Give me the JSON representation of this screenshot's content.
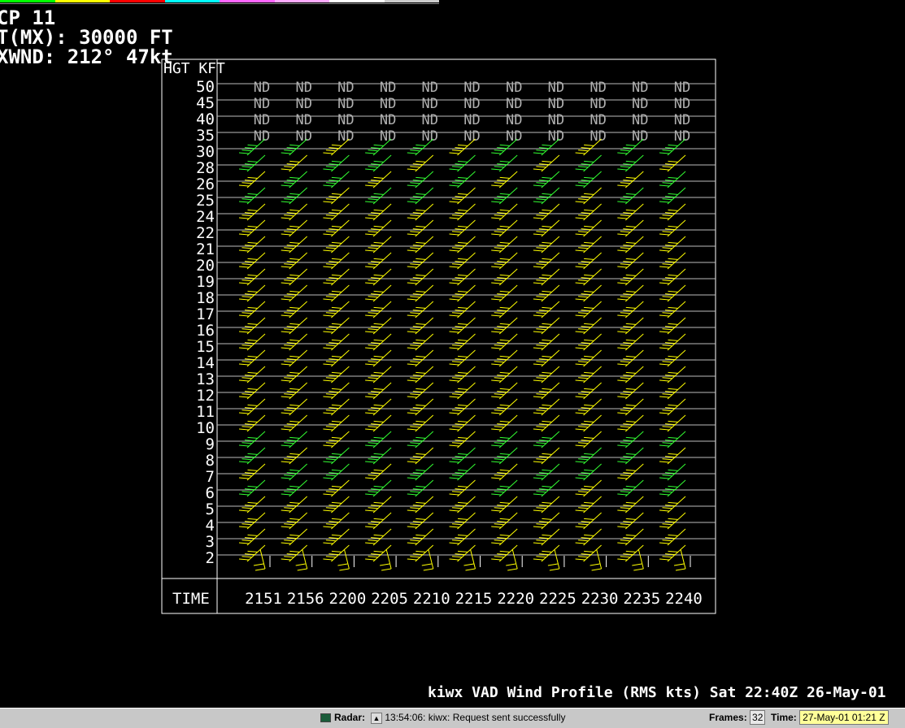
{
  "header": {
    "line1": "CP 11",
    "line2": "T(MX): 30000 FT",
    "line3": "XWND: 212° 47kt"
  },
  "palette": [
    "#00ff00",
    "#ffff00",
    "#ff0000",
    "#00ffff",
    "#ff66ff",
    "#ffaaff",
    "#ffffff",
    "#cccccc"
  ],
  "chart_data": {
    "type": "wind_profile",
    "ylabel": "HGT KFT",
    "xlabel": "TIME",
    "heights": [
      "50",
      "45",
      "40",
      "35",
      "30",
      "28",
      "26",
      "25",
      "24",
      "22",
      "21",
      "20",
      "19",
      "18",
      "17",
      "16",
      "15",
      "14",
      "13",
      "12",
      "11",
      "10",
      "9",
      "8",
      "7",
      "6",
      "5",
      "4",
      "3",
      "2"
    ],
    "times": [
      "2151",
      "2156",
      "2200",
      "2205",
      "2210",
      "2215",
      "2220",
      "2225",
      "2230",
      "2235",
      "2240"
    ],
    "nd_label": "ND",
    "nd_heights": [
      "50",
      "45",
      "40",
      "35"
    ],
    "wind_direction_deg": 212,
    "colors": {
      "yellow": "#ffff00",
      "green": "#33ff33",
      "grid": "#bbbbbb",
      "nd": "#b0b0b0"
    }
  },
  "footer": {
    "title": "kiwx VAD Wind Profile (RMS kts) Sat 22:40Z 26-May-01"
  },
  "statusbar": {
    "radar_label": "Radar:",
    "message": "13:54:06: kiwx: Request sent successfully",
    "frames_label": "Frames:",
    "frames_value": "32",
    "time_label": "Time:",
    "time_value": "27-May-01 01:21 Z"
  }
}
